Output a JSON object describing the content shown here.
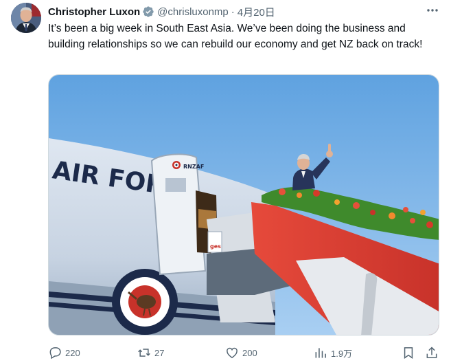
{
  "tweet": {
    "author": {
      "display_name": "Christopher Luxon",
      "handle": "@chrisluxonmp",
      "verified": true
    },
    "separator": "·",
    "date": "4月20日",
    "text": "It’s been a big week in South East Asia. We’ve been doing the business and building relationships so we can rebuild our economy and get NZ back on track!",
    "photo": {
      "fuselage_text": "AIR FOR",
      "door_text": "RNZAF",
      "stair_sign_text": "ges"
    }
  },
  "actions": {
    "reply_count": "220",
    "retweet_count": "27",
    "like_count": "200",
    "views_count": "1.9万"
  },
  "icons": {
    "more": "more-dots-icon",
    "verified": "verified-badge-icon",
    "reply": "reply-icon",
    "retweet": "retweet-icon",
    "like": "heart-icon",
    "views": "views-chart-icon",
    "bookmark": "bookmark-icon",
    "share": "share-icon"
  },
  "colors": {
    "text": "#0f1419",
    "secondary": "#536471",
    "verified_badge": "#829aab",
    "border": "#cfd9de"
  }
}
